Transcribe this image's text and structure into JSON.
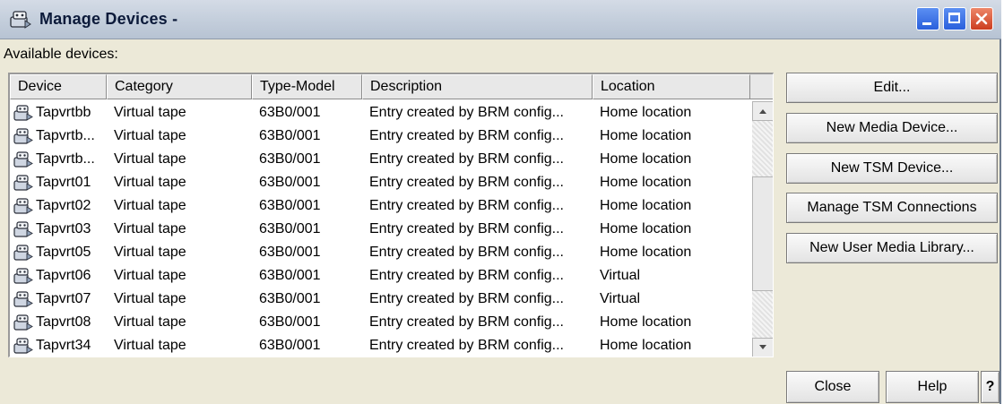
{
  "window": {
    "title": "Manage Devices -",
    "icon": "device-icon"
  },
  "available_label": "Available devices:",
  "table": {
    "columns": [
      "Device",
      "Category",
      "Type-Model",
      "Description",
      "Location"
    ],
    "rows": [
      {
        "device": "Tapvrtbb",
        "category": "Virtual tape",
        "type_model": "63B0/001",
        "description": "Entry created by BRM config...",
        "location": "Home location"
      },
      {
        "device": "Tapvrtb...",
        "category": "Virtual tape",
        "type_model": "63B0/001",
        "description": "Entry created by BRM config...",
        "location": "Home location"
      },
      {
        "device": "Tapvrtb...",
        "category": "Virtual tape",
        "type_model": "63B0/001",
        "description": "Entry created by BRM config...",
        "location": "Home location"
      },
      {
        "device": "Tapvrt01",
        "category": "Virtual tape",
        "type_model": "63B0/001",
        "description": "Entry created by BRM config...",
        "location": "Home location"
      },
      {
        "device": "Tapvrt02",
        "category": "Virtual tape",
        "type_model": "63B0/001",
        "description": "Entry created by BRM config...",
        "location": "Home location"
      },
      {
        "device": "Tapvrt03",
        "category": "Virtual tape",
        "type_model": "63B0/001",
        "description": "Entry created by BRM config...",
        "location": "Home location"
      },
      {
        "device": "Tapvrt05",
        "category": "Virtual tape",
        "type_model": "63B0/001",
        "description": "Entry created by BRM config...",
        "location": "Home location"
      },
      {
        "device": "Tapvrt06",
        "category": "Virtual tape",
        "type_model": "63B0/001",
        "description": "Entry created by BRM config...",
        "location": "Virtual"
      },
      {
        "device": "Tapvrt07",
        "category": "Virtual tape",
        "type_model": "63B0/001",
        "description": "Entry created by BRM config...",
        "location": "Virtual"
      },
      {
        "device": "Tapvrt08",
        "category": "Virtual tape",
        "type_model": "63B0/001",
        "description": "Entry created by BRM config...",
        "location": "Home location"
      },
      {
        "device": "Tapvrt34",
        "category": "Virtual tape",
        "type_model": "63B0/001",
        "description": "Entry created by BRM config...",
        "location": "Home location"
      }
    ]
  },
  "actions": {
    "edit": "Edit...",
    "new_media_device": "New Media Device...",
    "new_tsm_device": "New TSM Device...",
    "manage_tsm_connections": "Manage TSM Connections",
    "new_user_media_library": "New User Media Library..."
  },
  "footer": {
    "close": "Close",
    "help": "Help",
    "whats_this": "?"
  },
  "colors": {
    "titlebar": "#c6d0dd",
    "window_bg": "#ece9d8",
    "close_button": "#cc3d1f",
    "control_buttons": "#2a5fdc"
  }
}
